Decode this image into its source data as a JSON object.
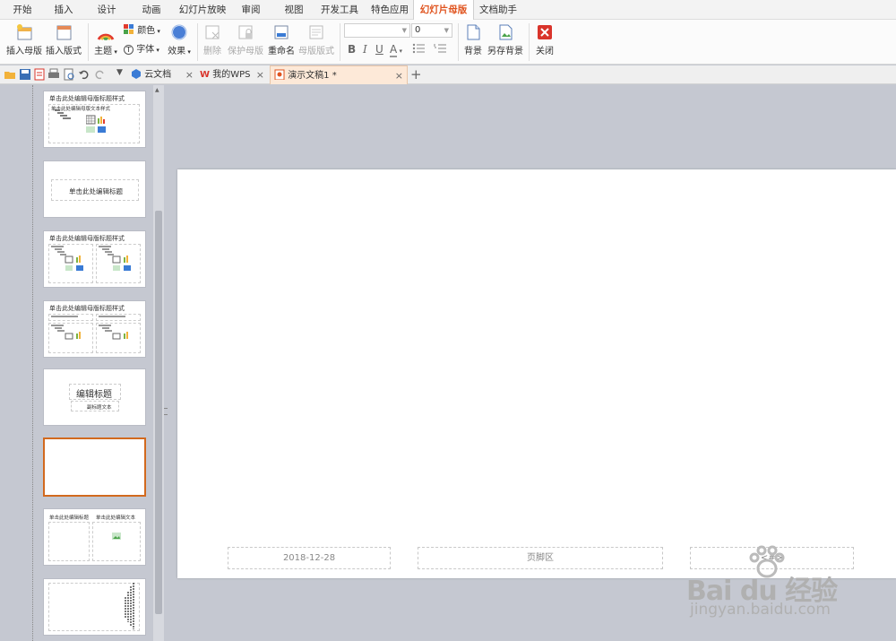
{
  "menu": {
    "tabs": [
      "开始",
      "插入",
      "设计",
      "动画",
      "幻灯片放映",
      "审阅",
      "视图",
      "开发工具",
      "特色应用",
      "幻灯片母版",
      "文档助手"
    ],
    "active_index": 9
  },
  "ribbon": {
    "insert_master": "插入母版",
    "insert_layout": "插入版式",
    "theme": "主题",
    "color": "颜色",
    "font": "字体",
    "effect": "效果",
    "delete": "删除",
    "protect_master": "保护母版",
    "rename": "重命名",
    "master_layout": "母版版式",
    "font_name_value": "",
    "font_size_value": "0",
    "bold": "B",
    "italic": "I",
    "underline": "U",
    "font_color": "A",
    "background": "背景",
    "save_background": "另存背景",
    "close": "关闭"
  },
  "doc_tabs": {
    "cloud": "云文档",
    "mywps": "我的WPS",
    "current": "演示文稿1 *"
  },
  "thumbnails": {
    "title_style": "单击此处编辑母版标题样式",
    "title_edit": "单击此处编辑标题",
    "big_title": "编辑标题",
    "subtitle": "副标题文本",
    "title_short": "单击此处编辑标题",
    "text_hint": "单击此处编辑文本",
    "body_text": "单击此处编辑母版文本样式"
  },
  "slide": {
    "date": "2018-12-28",
    "footer": "页脚区",
    "number": "<#>"
  },
  "watermark": {
    "brand": "Bai du 经验",
    "url": "jingyan.baidu.com"
  },
  "colors": {
    "accent": "#e0541f",
    "selected_border": "#d2691e",
    "workspace": "#c5c8d1",
    "close_red": "#d9342b"
  }
}
